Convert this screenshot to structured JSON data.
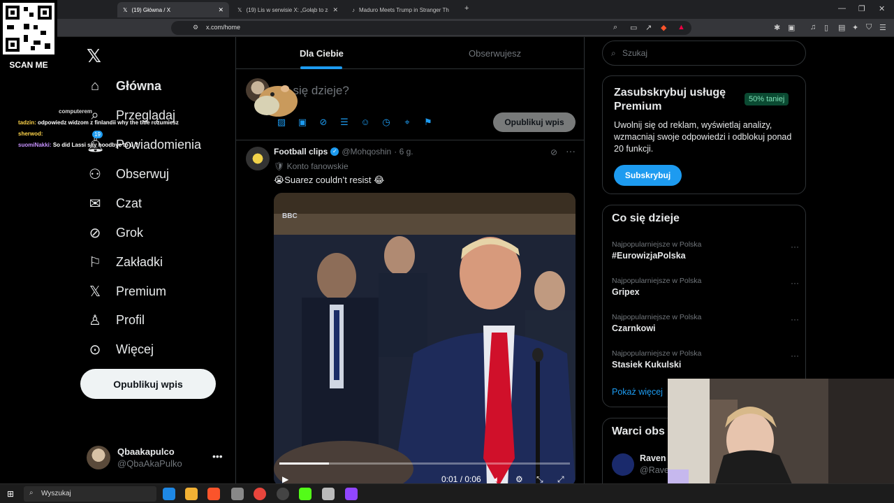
{
  "browser": {
    "tabs": [
      {
        "label": "(19) Główna / X"
      },
      {
        "label": "(19) Lis w serwisie X: „Gołąb to zakał"
      },
      {
        "label": "Maduro Meets Trump in Stranger Th"
      }
    ],
    "url": "x.com/home"
  },
  "overlay": {
    "scan_me": "SCAN ME",
    "chat": [
      {
        "user": "tadzin:",
        "text": "odpowiedz widzom z finlandii why the title rozumiesz"
      },
      {
        "user": "sherwod:",
        "text": ""
      },
      {
        "user": "suomiNakki:",
        "text": "So did Lassi say hoodbye to u ?"
      }
    ],
    "chat_fragment": "computerem"
  },
  "nav": {
    "items": [
      {
        "label": "Główna",
        "icon": "home-icon"
      },
      {
        "label": "Przeglądaj",
        "icon": "search-icon"
      },
      {
        "label": "Powiadomienia",
        "icon": "bell-icon",
        "badge": "19"
      },
      {
        "label": "Obserwuj",
        "icon": "follow-icon"
      },
      {
        "label": "Czat",
        "icon": "mail-icon"
      },
      {
        "label": "Grok",
        "icon": "grok-icon"
      },
      {
        "label": "Zakładki",
        "icon": "bookmark-icon"
      },
      {
        "label": "Premium",
        "icon": "x-logo-icon"
      },
      {
        "label": "Profil",
        "icon": "person-icon"
      },
      {
        "label": "Więcej",
        "icon": "more-circle-icon"
      }
    ],
    "post_button": "Opublikuj wpis",
    "profile": {
      "name": "Qbaakapulco",
      "handle": "@QbaAkaPulko"
    }
  },
  "feed": {
    "tabs": [
      "Dla Ciebie",
      "Obserwujesz"
    ],
    "compose_placeholder": "Co się dzieje?",
    "compose_button": "Opublikuj wpis",
    "tweet": {
      "name": "Football clips",
      "handle": "@Mohqoshin",
      "time": "· 6 g.",
      "label": "Konto fanowskie",
      "text": "😭Suarez couldn’t resist 😂",
      "video": {
        "time": "0:01 / 0:06",
        "progress": 0.17
      }
    }
  },
  "sidebar": {
    "search_placeholder": "Szukaj",
    "premium": {
      "title": "Zasubskrybuj usługę Premium",
      "badge": "50% taniej",
      "desc": "Uwolnij się od reklam, wyświetlaj analizy, wzmacniaj swoje odpowiedzi i odblokuj ponad 20 funkcji.",
      "button": "Subskrybuj"
    },
    "trends": {
      "title": "Co się dzieje",
      "items": [
        {
          "category": "Najpopularniejsze w Polska",
          "name": "#EurowizjaPolska"
        },
        {
          "category": "Najpopularniejsze w Polska",
          "name": "Gripex"
        },
        {
          "category": "Najpopularniejsze w Polska",
          "name": "Czarnkowi"
        },
        {
          "category": "Najpopularniejsze w Polska",
          "name": "Stasiek Kukulski"
        }
      ],
      "show_more": "Pokaż więcej"
    },
    "who": {
      "title": "Warci obs",
      "name": "Raven",
      "handle": "@Raven"
    }
  },
  "taskbar": {
    "search_placeholder": "Wyszukaj"
  },
  "colors": {
    "accent": "#1d9bf0",
    "background": "#000000",
    "border": "#2f3336",
    "muted": "#71767b"
  }
}
